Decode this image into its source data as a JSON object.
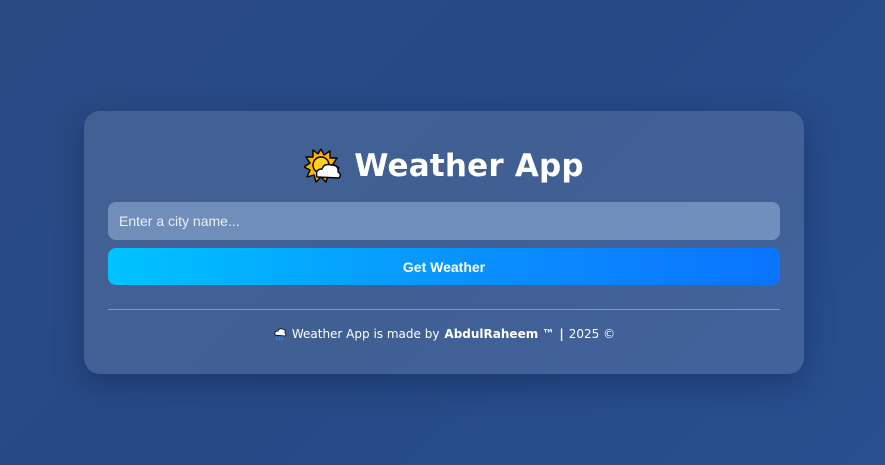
{
  "app": {
    "title": "Weather App",
    "title_icon": "sun-behind-cloud-icon"
  },
  "search": {
    "placeholder": "Enter a city name...",
    "value": ""
  },
  "actions": {
    "get_weather_label": "Get Weather"
  },
  "footer": {
    "icon": "cloud-with-rain-icon",
    "prefix": "Weather App is made by",
    "author": "AbdulRaheem ™",
    "separator": "|",
    "year_copy": "2025 ©"
  },
  "colors": {
    "background": "#284a88",
    "button_start": "#00c3ff",
    "button_end": "#0a74ff",
    "text": "#ffffff"
  }
}
